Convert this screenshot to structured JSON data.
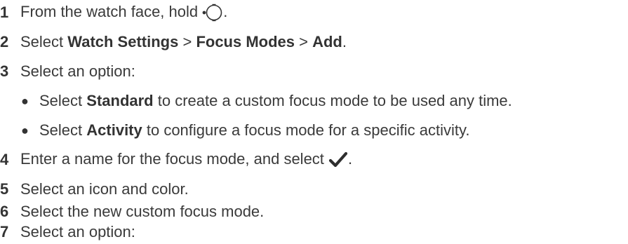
{
  "steps": [
    {
      "num": "1",
      "pre": "From the watch face, hold ",
      "icon": "watch-button-icon",
      "post": "."
    },
    {
      "num": "2",
      "pre": "Select ",
      "b1": "Watch Settings",
      "sep1": " > ",
      "b2": "Focus Modes",
      "sep2": " > ",
      "b3": "Add",
      "post": "."
    },
    {
      "num": "3",
      "text": "Select an option:",
      "bullets": [
        {
          "pre": "Select ",
          "bold": "Standard",
          "post": " to create a custom focus mode to be used any time."
        },
        {
          "pre": "Select ",
          "bold": "Activity",
          "post": " to configure a focus mode for a specific activity."
        }
      ]
    },
    {
      "num": "4",
      "pre": "Enter a name for the focus mode, and select ",
      "icon": "checkmark-icon",
      "post": "."
    },
    {
      "num": "5",
      "text": "Select an icon and color."
    },
    {
      "num": "6",
      "text": "Select the new custom focus mode."
    },
    {
      "num": "7",
      "text": "Select an option:"
    }
  ],
  "bullet_glyph": "●"
}
